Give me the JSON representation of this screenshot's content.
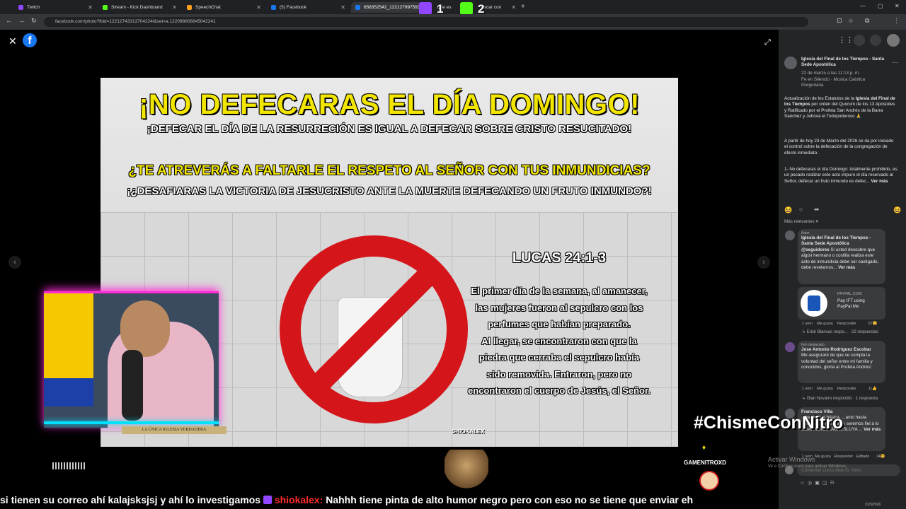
{
  "browser": {
    "tabs": [
      {
        "label": "Twitch",
        "color": "#9146ff"
      },
      {
        "label": "Stream - Kick Dashboard",
        "color": "#53fc18"
      },
      {
        "label": "SpeechChat",
        "color": "#ff9f1a"
      },
      {
        "label": "(5) Facebook",
        "color": "#1877f2"
      },
      {
        "label": "658352542_1221279975930",
        "color": "#1877f2"
      },
      {
        "label": "que es",
        "color": "#ffffff"
      },
      {
        "label": "uscar con",
        "color": "#ffffff"
      }
    ],
    "url": "facebook.com/photo?fbid=12212743313704224l&set=a.122098606845042241"
  },
  "overlay_counters": {
    "twitch": "1",
    "kick": "2"
  },
  "post_image": {
    "headline": "¡NO DEFECARAS EL DÍA DOMINGO!",
    "line2": "¡DEFECAR EL DÍA DE LA RESURRECIÓN ES IGUAL A DEFECAR SOBRE CRISTO RESUCITADO!",
    "line3": "¿TE ATREVERÁS A FALTARLE EL RESPETO AL SEÑOR CON TUS INMUNDICIAS?",
    "line4": "¡¿DESAFIARAS LA VICTORIA DE JESUCRISTO ANTE LA MUERTE DEFECANDO UN FRUTO INMUNDO?!",
    "verse_ref": "LUCAS 24:1-3",
    "verse_lines": [
      "El primer día de la semana, al amanecer,",
      "las mujeres fueron al sepulcro con los",
      "perfumes que habían preparado.",
      "Al llegar, se encontraron con que la",
      "piedra que cerraba el sepulcro había",
      "sido removida. Entraron, pero no",
      "encontraron el cuerpo de Jesús, el Señor."
    ],
    "watermark": "SHIOKALEX"
  },
  "webcam_label": "LA ÚNICA IGLESIA VERDADERA",
  "post": {
    "page_name": "Iglesia del Final de los Tiempos - Santa Sede Apostólica",
    "date": "22 de marzo a las 11:13 p. m.",
    "music": "Fe en Silencio · Musica Catolica Gregoriana",
    "body1_pre": "Actualización de los Estatutos de la ",
    "body1_bold": "Iglesia del Final de los Tiempos",
    "body1_post": " por orden del Quorum de los 13 Apostoles y Ratificado por el Profeta San Andrés de la Barra Sánchez y Jehová el Todopoderoso 🙏",
    "body2": "A partir de hoy 23 de Marzo del 2026 se da por iniciado el control sobre la defecación de la congregación de efecto inmediato.",
    "body3": "1- No defecaras el día Domingo: totalmente prohibido, es un pecado realizar este acto impuro el día reservado al Señor, defecar un fruto inmundo es defec...",
    "see_more": "Ver más",
    "sort_label": "Más relevantes"
  },
  "comments": [
    {
      "badge": "Autor",
      "author": "Iglesia del Final de los Tiempos - Santa Sede Apostólica",
      "mention": "@seguidores",
      "text": " Si usted descubre que algún hermano o costilla realiza este acto de inmundicia debe ser castigado, debe revelarnos...",
      "see_more": "Ver más",
      "ad_site": "PAYPAL.COM",
      "ad_title": "Pay IFT using PayPal.Me",
      "time": "1 sem",
      "like": "Me gusta",
      "reply": "Responder",
      "reactions": "67",
      "replies_line": "Erick Blancas respo... · 22 respuestas"
    },
    {
      "badge": "Fan destacado",
      "author": "Jose Antonio Rodriguez Escobar",
      "text": "Me aseguraré de que se cumpla la voluntad del señor entre mi familia y conocidos, gloria al Profeta Andrés!",
      "time": "1 sem",
      "like": "Me gusta",
      "reply": "Responder",
      "reactions": "11",
      "replies_line": "Glan Novarro respondió · 1 respuesta"
    },
    {
      "author": "Francisco Villa",
      "text": "...necesidad básica, ...anto hasta ...morales, siempre se seremos fiel a lo usted mande, ¡ADRESLUYA ...",
      "see_more": "Ver más",
      "time": "1 sem",
      "like": "Me gusta",
      "reply": "Responder",
      "edited": "Editado",
      "reactions": "14"
    }
  ],
  "comment_box": {
    "placeholder": "Comentar como Alex G. Nitro"
  },
  "windows_activation": {
    "title": "Activar Windows",
    "subtitle": "Ve a Configuración para activar Windows."
  },
  "stream_overlay": {
    "hashtag": "#ChismeConNitro",
    "viewer_name": "GAMENITROXD",
    "ticker_pre": "si tienen su correo ahí kalajsksjsj y ahí lo investigamos",
    "ticker_user": "shiokalex:",
    "ticker_post": "Nahhh tiene pinta de alto humor negro pero con eso no se tiene que enviar eh"
  },
  "clock": {
    "date": "31/3/2026"
  }
}
